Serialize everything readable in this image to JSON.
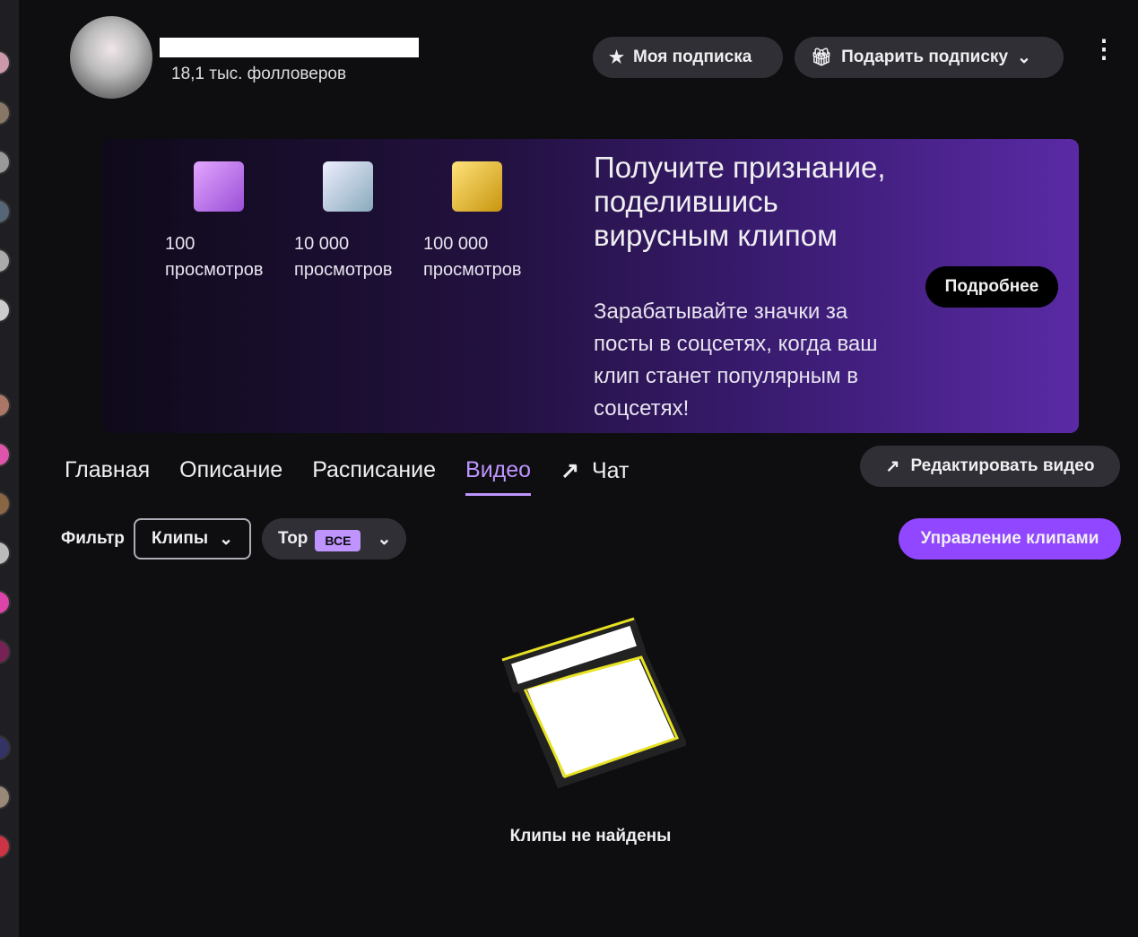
{
  "channel": {
    "name_redacted": true,
    "followers": "18,1 тыс. фолловеров"
  },
  "header": {
    "my_sub": "Моя подписка",
    "gift_sub": "Подарить подписку"
  },
  "banner": {
    "badges": [
      {
        "value": "100",
        "label": "просмотров"
      },
      {
        "value": "10 000",
        "label": "просмотров"
      },
      {
        "value": "100 000",
        "label": "просмотров"
      }
    ],
    "title": "Получите признание, поделившись вирусным клипом",
    "subtitle": "Зарабатывайте значки за посты в соцсетях, когда ваш клип станет популярным в соцсетях!",
    "button": "Подробнее"
  },
  "tabs": [
    {
      "label": "Главная"
    },
    {
      "label": "Описание"
    },
    {
      "label": "Расписание"
    },
    {
      "label": "Видео",
      "active": true
    },
    {
      "label": "Чат"
    }
  ],
  "edit_video": "Редактировать видео",
  "filter": {
    "label": "Фильтр",
    "type": "Клипы",
    "sort": "Top",
    "sort_badge": "ВСЕ"
  },
  "manage_clips": "Управление клипами",
  "empty_text": "Клипы не найдены",
  "colors": {
    "accent": "#9147ff",
    "accent_light": "#bf94ff",
    "bg": "#0e0e10"
  }
}
